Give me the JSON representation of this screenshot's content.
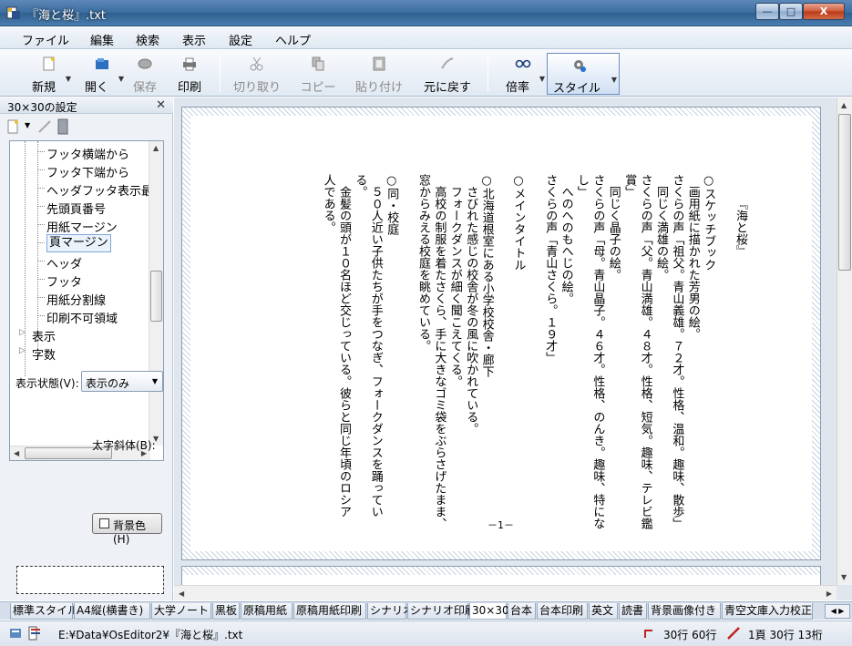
{
  "window": {
    "title": "『海と桜』.txt",
    "minimize": "—",
    "maximize": "□",
    "close": "X"
  },
  "menu": [
    "ファイル",
    "編集",
    "検索",
    "表示",
    "設定",
    "ヘルプ"
  ],
  "toolbar": {
    "new": "新規",
    "open": "開く",
    "save": "保存",
    "print": "印刷",
    "cut": "切り取り",
    "copy": "コピー",
    "paste": "貼り付け",
    "undo": "元に戻す",
    "zoom": "倍率",
    "style": "スタイル"
  },
  "left_panel": {
    "title": "30×30の設定",
    "tree_items": [
      "フッタ横端から",
      "フッタ下端から",
      "ヘッダフッタ表示最",
      "先頭頁番号",
      "用紙マージン",
      "頁マージン",
      "ヘッダ",
      "フッタ",
      "用紙分割線",
      "印刷不可領域",
      "表示",
      "字数"
    ],
    "selected_item": "頁マージン",
    "display_state_label": "表示状態(V):",
    "display_state_value": "表示のみ",
    "bold_italic_label": "太字斜体(B):",
    "bgcolor_label": "背景色(H)"
  },
  "document": {
    "columns": [
      "『海と桜』",
      "",
      "○スケッチブック",
      "　画用紙に描かれた芳男の絵。",
      "さくらの声「祖父。青山義雄。７２才。性格、温和。趣味、散歩」",
      "　同じく満雄の絵。",
      "さくらの声「父。青山満雄。４８才。性格、短気。趣味、テレビ鑑",
      "賞」",
      "　同じく晶子の絵。",
      "さくらの声「母。青山晶子。４６才。性格、のんき。趣味、特にな",
      "し」",
      "　へのへのもへじの絵。",
      "さくらの声「青山さくら。１９才」",
      "",
      "○メインタイトル",
      "",
      "○北海道根室にある小学校校舎・廊下",
      "　さびれた感じの校舎が冬の風に吹かれている。",
      "　フォークダンスが細く聞こえてくる。",
      "　高校の制服を着たさくら、手に大きなゴミ袋をぶらさげたまま、",
      "窓からみえる校庭を眺めている。",
      "",
      "○同・校庭",
      "　５０人近い子供たちが手をつなぎ、フォークダンスを踊ってい",
      "る。",
      "　金髪の頭が１０名ほど交じっている。彼らと同じ年頃のロシア",
      "人である。"
    ],
    "page_number": "－1－"
  },
  "style_tabs": [
    "標準スタイル",
    "A4縦(横書き)",
    "大学ノート",
    "黒板",
    "原稿用紙",
    "原稿用紙印刷",
    "シナリオ",
    "シナリオ印刷",
    "30×30",
    "台本",
    "台本印刷",
    "英文",
    "読書",
    "背景画像付き",
    "青空文庫入力校正"
  ],
  "active_style_tab": "30×30",
  "status": {
    "path": "E:¥Data¥OsEditor2¥『海と桜』.txt",
    "page_info": "30行 60行",
    "cursor": "1頁 30行 13桁"
  },
  "colors": {
    "title_bar": "#3a6d9f",
    "accent": "#6b8fc0"
  }
}
